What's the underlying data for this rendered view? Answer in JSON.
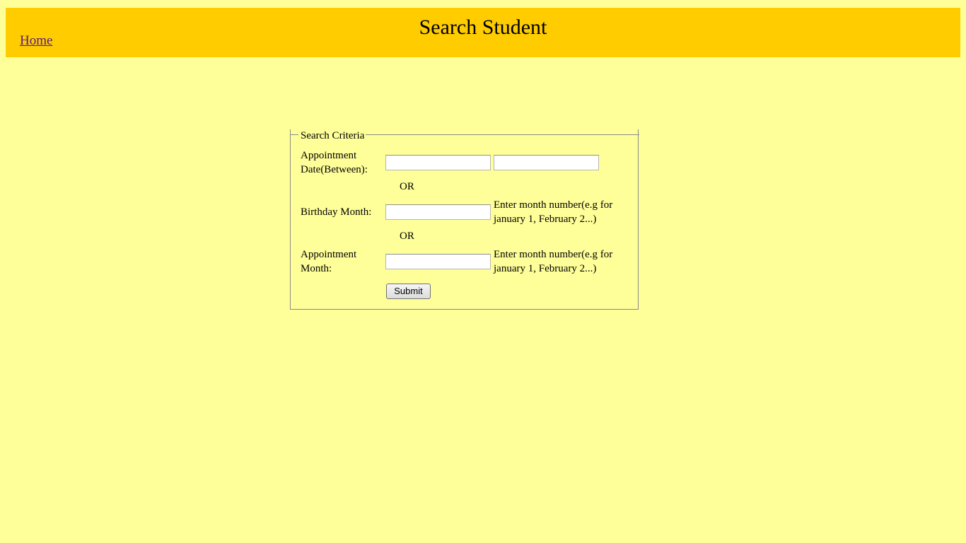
{
  "header": {
    "title": "Search Student",
    "home_link": "Home"
  },
  "form": {
    "legend": "Search Criteria",
    "appointment_date_label": "Appointment Date(Between):",
    "appointment_date_from": {
      "value": "",
      "placeholder": ""
    },
    "appointment_date_to": {
      "value": "",
      "placeholder": ""
    },
    "or_1": "OR",
    "birthday_month_label": "Birthday Month:",
    "birthday_month": {
      "value": "",
      "placeholder": ""
    },
    "birthday_month_hint": "Enter month number(e.g for january 1, February 2...)",
    "or_2": "OR",
    "appointment_month_label": "Appointment Month:",
    "appointment_month": {
      "value": "",
      "placeholder": ""
    },
    "appointment_month_hint": "Enter month number(e.g for january 1, February 2...)",
    "submit_label": "Submit"
  },
  "colors": {
    "page_background": "#ffff99",
    "header_background": "#ffcc00",
    "link": "#551a8b"
  }
}
